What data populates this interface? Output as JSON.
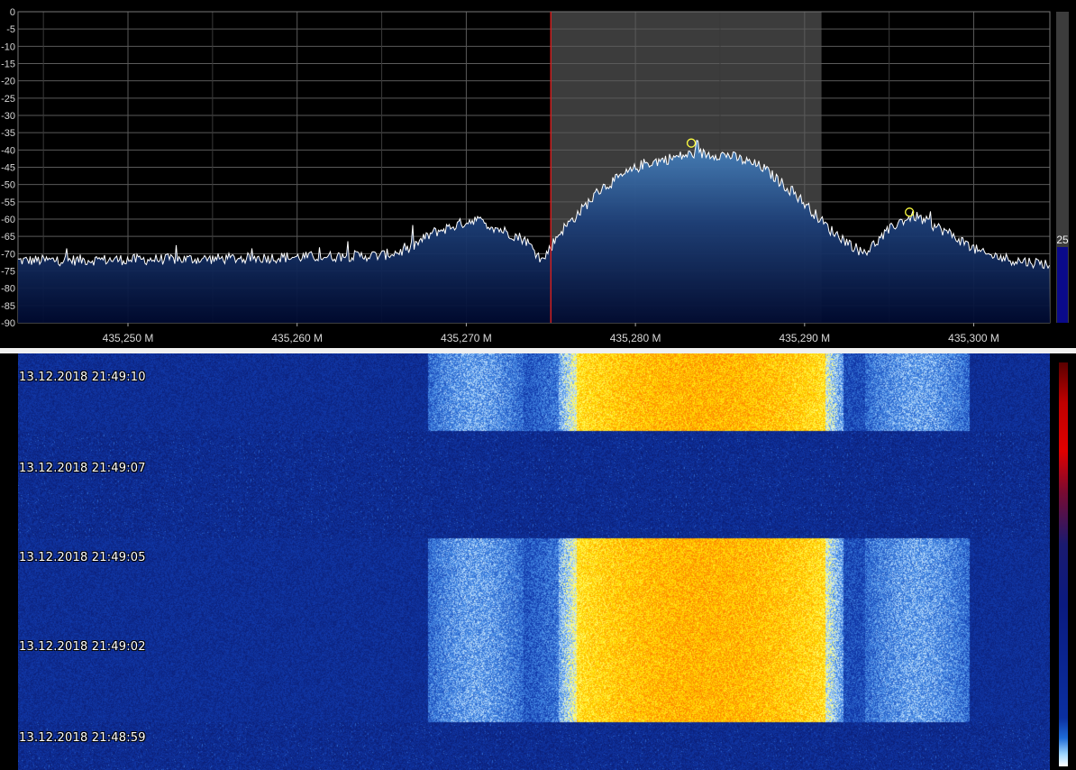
{
  "spectrum": {
    "y_ticks": [
      "0",
      "-5",
      "-10",
      "-15",
      "-20",
      "-25",
      "-30",
      "-35",
      "-40",
      "-45",
      "-50",
      "-55",
      "-60",
      "-65",
      "-70",
      "-75",
      "-80",
      "-85",
      "-90"
    ],
    "x_ticks": [
      "435,250 M",
      "435,260 M",
      "435,270 M",
      "435,280 M",
      "435,290 M",
      "435,300 M"
    ],
    "level_value": "25",
    "colors": {
      "grid": "#5a5a5a",
      "trace": "#ffffff",
      "fill_top": "#4a86c0",
      "fill_bottom": "#000a30",
      "passband": "#3c3c3c",
      "center_line": "#d02020",
      "peak_marker": "#ffff40",
      "level_bar": "#0a0a8a"
    }
  },
  "waterfall": {
    "timestamps": [
      "13.12.2018 21:49:10",
      "13.12.2018 21:49:07",
      "13.12.2018 21:49:05",
      "13.12.2018 21:49:02",
      "13.12.2018 21:48:59"
    ]
  },
  "chart_data": {
    "type": "line",
    "xlim": [
      435.2435,
      435.3045
    ],
    "ylim": [
      -90,
      0
    ],
    "grid": true,
    "series_points": [
      [
        435.2435,
        -72
      ],
      [
        435.255,
        -71.5
      ],
      [
        435.265,
        -70.5
      ],
      [
        435.2665,
        -69
      ],
      [
        435.268,
        -64
      ],
      [
        435.2705,
        -60
      ],
      [
        435.272,
        -63
      ],
      [
        435.2735,
        -66
      ],
      [
        435.2745,
        -72
      ],
      [
        435.2755,
        -64
      ],
      [
        435.2765,
        -59
      ],
      [
        435.278,
        -51
      ],
      [
        435.2805,
        -44
      ],
      [
        435.2835,
        -41
      ],
      [
        435.2855,
        -41.5
      ],
      [
        435.2875,
        -45
      ],
      [
        435.2895,
        -53
      ],
      [
        435.2915,
        -63
      ],
      [
        435.2935,
        -70
      ],
      [
        435.2955,
        -61
      ],
      [
        435.2965,
        -59
      ],
      [
        435.2985,
        -64
      ],
      [
        435.3005,
        -70
      ],
      [
        435.3025,
        -72
      ],
      [
        435.3045,
        -73
      ]
    ],
    "passband": [
      435.275,
      435.291
    ],
    "center_frequency": 435.275,
    "peak_markers": [
      [
        435.2833,
        -38
      ],
      [
        435.2962,
        -58
      ]
    ]
  }
}
